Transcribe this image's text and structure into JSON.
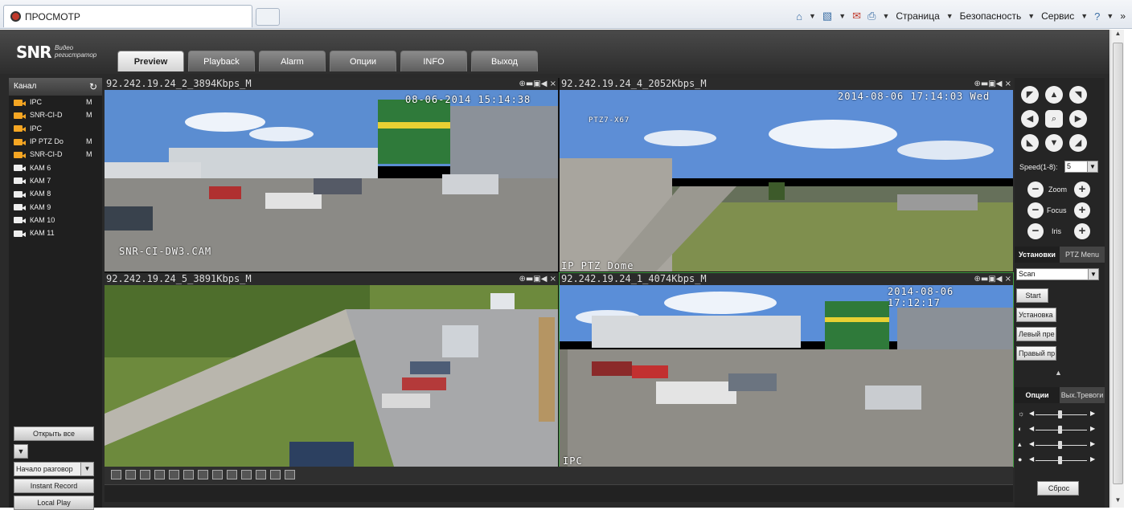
{
  "browser": {
    "tab_title": "ПРОСМОТР",
    "menu": [
      "Страница",
      "Безопасность",
      "Сервис"
    ],
    "more": "»"
  },
  "app": {
    "logo": "SNR",
    "logo_sub_1": "Видео",
    "logo_sub_2": "регистратор",
    "nav_tabs": [
      "Preview",
      "Playback",
      "Alarm",
      "Опции",
      "INFO",
      "Выход"
    ],
    "active_tab": "Preview"
  },
  "channels": {
    "header": "Канал",
    "refresh_icon": "↻",
    "items": [
      {
        "name": "IPC",
        "mark": "M",
        "active": true
      },
      {
        "name": "SNR-CI-D",
        "mark": "M",
        "active": true
      },
      {
        "name": "IPC",
        "mark": "",
        "active": true
      },
      {
        "name": "IP PTZ Do",
        "mark": "M",
        "active": true
      },
      {
        "name": "SNR-CI-D",
        "mark": "M",
        "active": true
      },
      {
        "name": "КАМ 6",
        "mark": "",
        "active": false
      },
      {
        "name": "КАМ 7",
        "mark": "",
        "active": false
      },
      {
        "name": "КАМ 8",
        "mark": "",
        "active": false
      },
      {
        "name": "КАМ 9",
        "mark": "",
        "active": false
      },
      {
        "name": "КАМ 10",
        "mark": "",
        "active": false
      },
      {
        "name": "КАМ 11",
        "mark": "",
        "active": false
      }
    ],
    "open_all": "Открыть все",
    "talk_select": "Начало разговор",
    "instant_record": "Instant Record",
    "local_play": "Local Play"
  },
  "video": [
    {
      "title": "92.242.19.24_2_3894Kbps_M",
      "osd_time": "08-06-2014 15:14:38",
      "osd_name": "SNR-CI-DW3.CAM",
      "selected": false
    },
    {
      "title": "92.242.19.24_4_2052Kbps_M",
      "osd_time": "2014-08-06 17:14:03 Wed",
      "osd_name": "IP PTZ Dome",
      "osd_extra": "PTZ7-X67",
      "selected": false
    },
    {
      "title": "92.242.19.24_5_3891Kbps_M",
      "osd_time": "",
      "osd_name": "",
      "selected": false
    },
    {
      "title": "92.242.19.24_1_4074Kbps_M",
      "osd_time": "2014-08-06 17:12:17",
      "osd_name": "IPC",
      "selected": true
    }
  ],
  "cell_controls": "⊕▬▣◀ ×",
  "ptz": {
    "speed_label": "Speed(1-8):",
    "speed_value": "5",
    "zoom_label": "Zoom",
    "focus_label": "Focus",
    "iris_label": "Iris",
    "tabs": [
      "Установки",
      "PTZ Menu"
    ],
    "mode_select": "Scan",
    "buttons": [
      "Start",
      "Установка",
      "Левый пре",
      "Правый пр"
    ],
    "bottom_tabs": [
      "Опции",
      "Вых.Тревоги"
    ],
    "reset": "Сброс"
  }
}
